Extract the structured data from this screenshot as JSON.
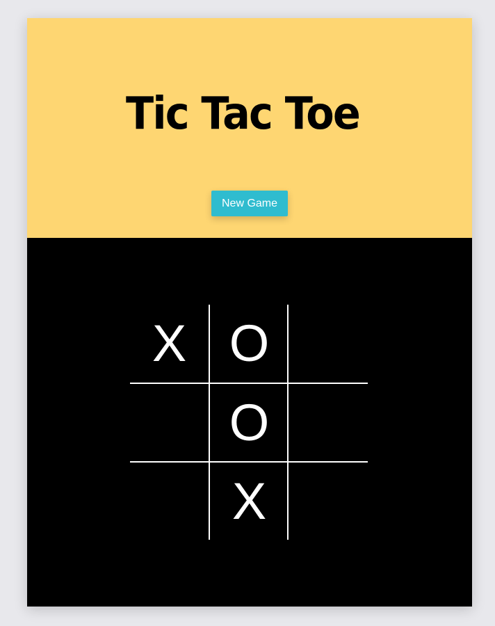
{
  "header": {
    "title": "Tic Tac Toe",
    "new_game_label": "New Game"
  },
  "board": {
    "cells": [
      "X",
      "O",
      "",
      "",
      "O",
      "",
      "",
      "X",
      ""
    ]
  },
  "colors": {
    "header_bg": "#fed672",
    "button_bg": "#2fbccf",
    "board_bg": "#000000",
    "marks": "#ffffff"
  }
}
